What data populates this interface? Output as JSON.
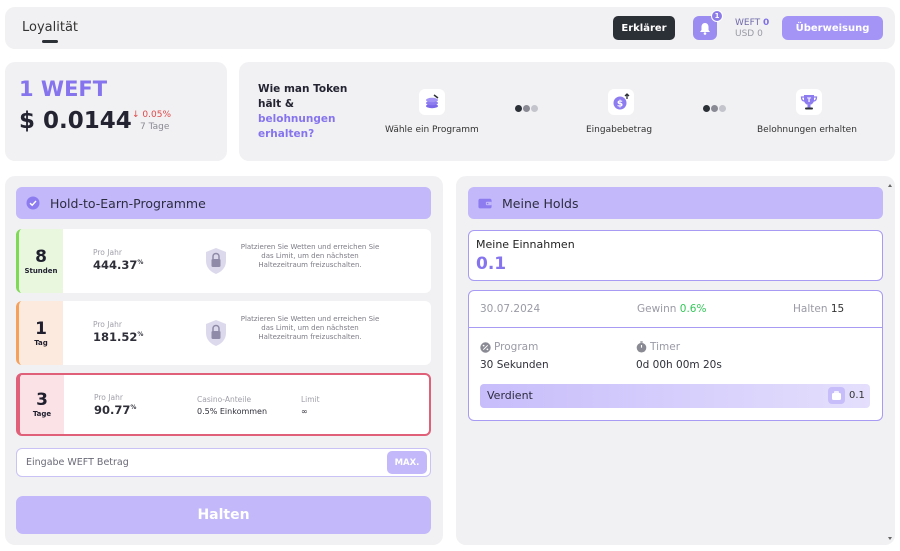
{
  "topbar": {
    "title": "Loyalität",
    "explainer_label": "Erklärer",
    "notification_count": "1",
    "balance_weft_label": "WEFT",
    "balance_weft_value": "0",
    "balance_usd": "USD 0",
    "transfer_label": "Überweisung"
  },
  "price": {
    "token": "1 WEFT",
    "usd": "$ 0.0144",
    "change": "0.05%",
    "change_direction": "down",
    "period": "7 Tage"
  },
  "howto": {
    "title_line1": "Wie man Token",
    "title_line2": "hält &",
    "title_highlight": "belohnungen erhalten?",
    "steps": [
      {
        "label": "Wähle ein Programm",
        "icon": "coin-stack-icon"
      },
      {
        "label": "Eingabebetrag",
        "icon": "dollar-deposit-icon"
      },
      {
        "label": "Belohnungen erhalten",
        "icon": "trophy-icon"
      }
    ]
  },
  "programs": {
    "header": "Hold-to-Earn-Programme",
    "items": [
      {
        "num": "8",
        "unit": "Stunden",
        "per_label": "Pro Jahr",
        "rate": "444.37",
        "rate_unit": "%",
        "locked": true,
        "desc": "Platzieren Sie Wetten und erreichen Sie das Limit, um den nächsten Haltezeitraum freizuschalten.",
        "accent": "#7ed957",
        "side_bg": "#e9f7df"
      },
      {
        "num": "1",
        "unit": "Tag",
        "per_label": "Pro Jahr",
        "rate": "181.52",
        "rate_unit": "%",
        "locked": true,
        "desc": "Platzieren Sie Wetten und erreichen Sie das Limit, um den nächsten Haltezeitraum freizuschalten.",
        "accent": "#f5a15c",
        "side_bg": "#fdeadf"
      },
      {
        "num": "3",
        "unit": "Tage",
        "per_label": "Pro Jahr",
        "rate": "90.77",
        "rate_unit": "%",
        "locked": false,
        "casino_label": "Casino-Anteile",
        "casino_value": "0.5% Einkommen",
        "limit_label": "Limit",
        "limit_value": "∞",
        "accent": "#e0607a",
        "side_bg": "#fbe2e6"
      }
    ],
    "input_placeholder": "Eingabe WEFT Betrag",
    "max_label": "MAX.",
    "hold_label": "Halten"
  },
  "holds": {
    "header": "Meine Holds",
    "earnings_label": "Meine Einnahmen",
    "earnings_value": "0.1",
    "item": {
      "date": "30.07.2024",
      "gain_label": "Gewinn",
      "gain_value": "0.6%",
      "hold_label": "Halten",
      "hold_value": "15",
      "program_label": "Program",
      "program_value": "30 Sekunden",
      "timer_label": "Timer",
      "timer_value": "0d 00h 00m 20s",
      "earned_label": "Verdient",
      "earned_value": "0.1",
      "earned_progress": 1.0
    }
  },
  "colors": {
    "accent": "#8574ee",
    "accent_light": "#c2b8fa",
    "dark": "#2b2f36",
    "positive": "#34c759",
    "negative": "#e04848"
  }
}
